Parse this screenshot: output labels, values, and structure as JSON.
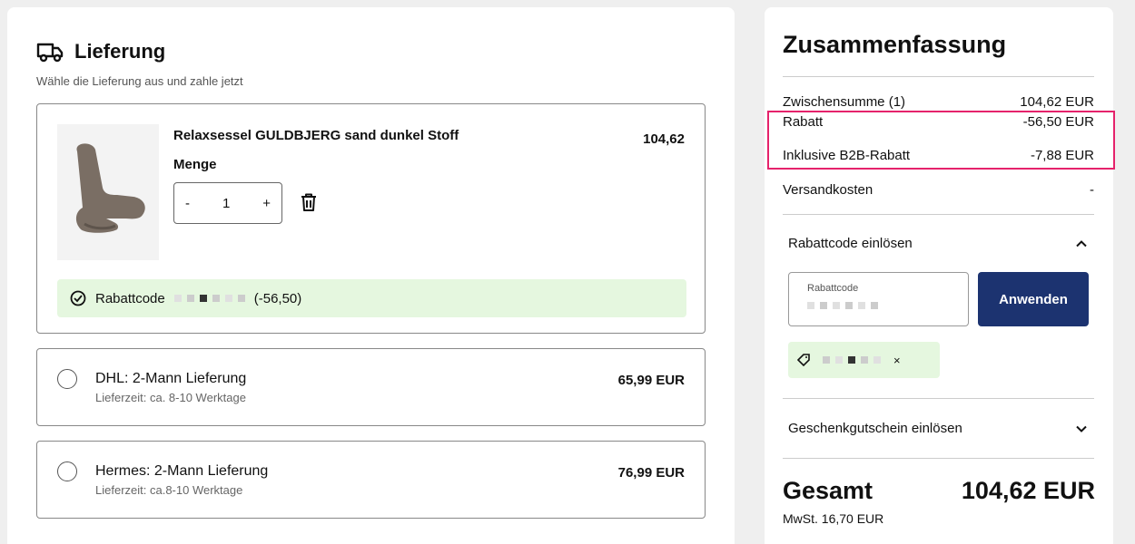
{
  "delivery": {
    "title": "Lieferung",
    "subtitle": "Wähle die Lieferung aus und zahle jetzt"
  },
  "product": {
    "name": "Relaxsessel GULDBJERG sand dunkel Stoff",
    "price": "104,62",
    "quantity_label": "Menge",
    "quantity": "1",
    "minus": "-",
    "plus": "+",
    "promo_prefix": "Rabattcode",
    "promo_amount": "(-56,50)"
  },
  "shipping": [
    {
      "name": "DHL: 2-Mann Lieferung",
      "time": "Lieferzeit: ca. 8-10 Werktage",
      "price": "65,99 EUR"
    },
    {
      "name": "Hermes: 2-Mann Lieferung",
      "time": "Lieferzeit: ca.8-10 Werktage",
      "price": "76,99 EUR"
    }
  ],
  "summary": {
    "title": "Zusammenfassung",
    "subtotal_label": "Zwischensumme (1)",
    "subtotal_value": "104,62 EUR",
    "discount_label": "Rabatt",
    "discount_value": "-56,50 EUR",
    "b2b_label": "Inklusive B2B-Rabatt",
    "b2b_value": "-7,88 EUR",
    "shipping_label": "Versandkosten",
    "shipping_value": "-",
    "redeem_code_label": "Rabattcode einlösen",
    "code_field_label": "Rabattcode",
    "apply_label": "Anwenden",
    "tag_remove": "×",
    "gift_card_label": "Geschenkgutschein einlösen",
    "total_label": "Gesamt",
    "total_value": "104,62 EUR",
    "vat_text": "MwSt. 16,70 EUR"
  },
  "colors": {
    "primary_button": "#1c3370",
    "success_bg": "#e5f7df",
    "highlight_border": "#e5226b"
  }
}
